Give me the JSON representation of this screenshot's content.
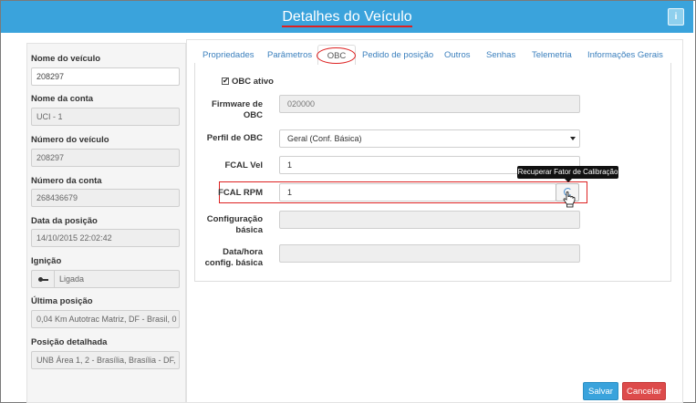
{
  "header": {
    "title": "Detalhes do Veículo",
    "info_label": "i"
  },
  "sidebar": {
    "fields": [
      {
        "label": "Nome do veículo",
        "value": "208297"
      },
      {
        "label": "Nome da conta",
        "value": "UCI - 1"
      },
      {
        "label": "Número do veículo",
        "value": "208297"
      },
      {
        "label": "Número da conta",
        "value": "268436679"
      },
      {
        "label": "Data da posição",
        "value": "14/10/2015 22:02:42"
      },
      {
        "label": "Ignição",
        "value": "Ligada"
      },
      {
        "label": "Última posição",
        "value": "0,04 Km Autotrac Matriz, DF - Brasil, 0"
      },
      {
        "label": "Posição detalhada",
        "value": "UNB Área 1, 2 - Brasília, Brasília - DF,"
      }
    ]
  },
  "tabs": [
    "Propriedades",
    "Parâmetros",
    "OBC",
    "Pedido de posição",
    "Outros",
    "Senhas",
    "Telemetria",
    "Informações Gerais"
  ],
  "obc": {
    "active_label": "OBC ativo",
    "active_check": "✔",
    "firmware_label_1": "Firmware de",
    "firmware_label_2": "OBC",
    "firmware_value": "020000",
    "perfil_label": "Perfil de OBC",
    "perfil_value": "Geral (Conf. Básica)",
    "fcal_vel_label": "FCAL Vel",
    "fcal_vel_value": "1",
    "fcal_rpm_label": "FCAL RPM",
    "fcal_rpm_value": "1",
    "config_label_1": "Configuração",
    "config_label_2": "básica",
    "config_value": "",
    "datahora_label_1": "Data/hora",
    "datahora_label_2": "config. básica",
    "datahora_value": "",
    "tooltip": "Recuperar Fator de Calibração"
  },
  "buttons": {
    "save": "Salvar",
    "cancel": "Cancelar"
  },
  "colors": {
    "header": "#3aa3dc",
    "save": "#3aa3dc",
    "cancel": "#dd4b4b",
    "highlight": "#dd2222"
  }
}
